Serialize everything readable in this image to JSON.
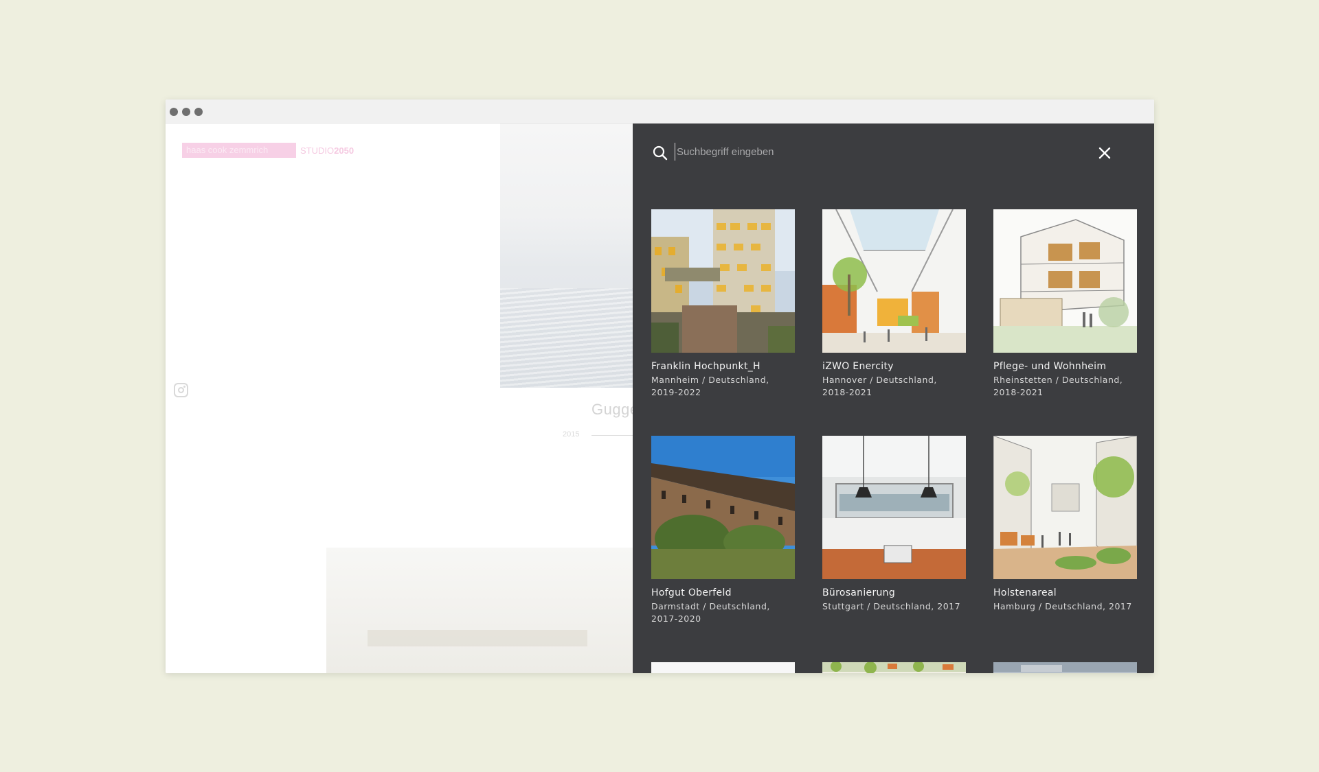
{
  "site": {
    "logo_name": "haas cook zemmrich",
    "logo_studio_prefix": "STUDIO",
    "logo_studio_number": "2050",
    "project_title": "Gugge",
    "project_year": "2015"
  },
  "search": {
    "placeholder": "Suchbegriff eingeben",
    "value": ""
  },
  "results": [
    {
      "title": "Franklin Hochpunkt_H",
      "subtitle": "Mannheim / Deutschland, 2019-2022"
    },
    {
      "title": "iZWO Enercity",
      "subtitle": "Hannover / Deutschland, 2018-2021"
    },
    {
      "title": "Pflege- und Wohnheim",
      "subtitle": "Rheinstetten / Deutschland, 2018-2021"
    },
    {
      "title": "Hofgut Oberfeld",
      "subtitle": "Darmstadt / Deutschland, 2017-2020"
    },
    {
      "title": "Bürosanierung",
      "subtitle": "Stuttgart / Deutschland, 2017"
    },
    {
      "title": "Holstenareal",
      "subtitle": "Hamburg / Deutschland, 2017"
    }
  ],
  "icons": {
    "search": "search-icon",
    "close": "close-icon",
    "instagram": "instagram-icon"
  },
  "colors": {
    "page_background": "#eeefdf",
    "overlay_background": "#3c3d40",
    "logo_pink": "#f7d0e6"
  }
}
